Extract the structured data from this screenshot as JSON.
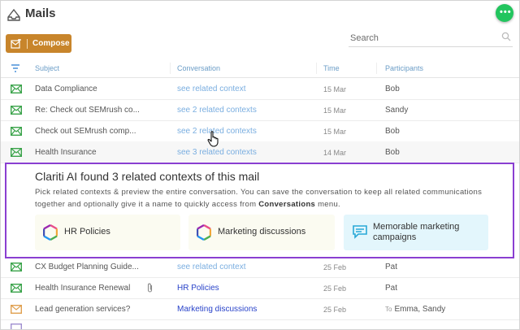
{
  "app": {
    "title": "Mails",
    "compose_label": "Compose"
  },
  "search": {
    "placeholder": "Search"
  },
  "columns": {
    "subject": "Subject",
    "conversation": "Conversation",
    "time": "Time",
    "participants": "Participants"
  },
  "rows": [
    {
      "subject": "Data Compliance",
      "conversation": "see related context",
      "time": "15 Mar",
      "participants": "Bob"
    },
    {
      "subject": "Re: Check out SEMrush co...",
      "conversation": "see 2 related contexts",
      "time": "15 Mar",
      "participants": "Sandy"
    },
    {
      "subject": "Check out SEMrush comp...",
      "conversation": "see 2 related contexts",
      "time": "15 Mar",
      "participants": "Bob"
    },
    {
      "subject": "Health Insurance",
      "conversation": "see 3 related contexts",
      "time": "14 Mar",
      "participants": "Bob"
    },
    {
      "subject": "CX Budget Planning Guide...",
      "conversation": "see related context",
      "time": "25 Feb",
      "participants": "Pat"
    },
    {
      "subject": "Health Insurance Renewal",
      "conversation": "HR Policies",
      "time": "25 Feb",
      "participants": "Pat"
    },
    {
      "subject": "Lead generation services?",
      "conversation": "Marketing discussions",
      "time": "25 Feb",
      "participants": "Emma, Sandy",
      "participants_prefix": "To"
    }
  ],
  "panel": {
    "title": "Clariti AI found 3 related contexts of this mail",
    "desc_1": "Pick related contexts & preview the entire conversation. You can save the conversation to keep all related communications together and optionally give it a name to quickly access from ",
    "desc_bold": "Conversations",
    "desc_2": " menu.",
    "cards": [
      {
        "label": "HR Policies",
        "icon": "hexagon-logo-icon"
      },
      {
        "label": "Marketing discussions",
        "icon": "hexagon-logo-icon"
      },
      {
        "label_line1": "Memorable marketing",
        "label_line2": "campaigns",
        "icon": "chat-bubble-icon"
      }
    ]
  },
  "colors": {
    "accent": "#c8852b",
    "panel_border": "#8a3fd1",
    "link": "#7aaee0",
    "link_dark": "#2943c9",
    "mail_icon": "#3aa34a"
  }
}
